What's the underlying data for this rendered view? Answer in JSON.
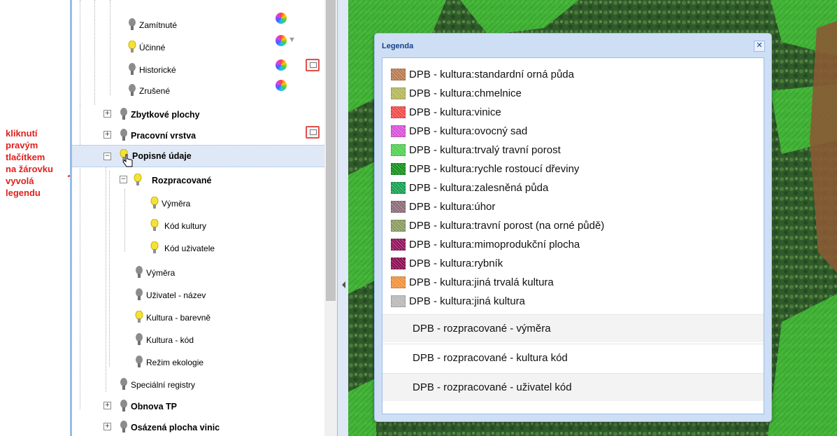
{
  "annotation": {
    "lines": [
      "kliknutí",
      "pravým",
      "tlačítkem",
      "na žárovku",
      "vyvolá",
      "legendu"
    ],
    "color": "#e0201c"
  },
  "tree": {
    "items": [
      {
        "label": "Zamítnuté",
        "bulb": "gray"
      },
      {
        "label": "Účinné",
        "bulb": "yellow"
      },
      {
        "label": "Historické",
        "bulb": "gray"
      },
      {
        "label": "Zrušené",
        "bulb": "gray"
      },
      {
        "label": "Zbytkové plochy",
        "bulb": "gray"
      },
      {
        "label": "Pracovní vrstva",
        "bulb": "gray"
      },
      {
        "label": "Popisné údaje",
        "bulb": "yellow"
      },
      {
        "label": "Rozpracované",
        "bulb": "yellow"
      },
      {
        "label": "Výměra",
        "bulb": "yellow"
      },
      {
        "label": "Kód kultury",
        "bulb": "yellow"
      },
      {
        "label": "Kód uživatele",
        "bulb": "yellow"
      },
      {
        "label": "Výměra",
        "bulb": "gray"
      },
      {
        "label": "Uživatel - název",
        "bulb": "gray"
      },
      {
        "label": "Kultura - barevně",
        "bulb": "yellow"
      },
      {
        "label": "Kultura - kód",
        "bulb": "gray"
      },
      {
        "label": "Režim ekologie",
        "bulb": "gray"
      },
      {
        "label": "Speciální registry",
        "bulb": "gray"
      },
      {
        "label": "Obnova TP",
        "bulb": "gray"
      },
      {
        "label": "Osázená plocha vinic",
        "bulb": "gray"
      }
    ],
    "expander_plus": "+",
    "expander_minus": "−"
  },
  "legend": {
    "title": "Legenda",
    "close": "✕",
    "items": [
      {
        "label": "DPB - kultura:standardní orná půda",
        "color": "#b87a4f"
      },
      {
        "label": "DPB - kultura:chmelnice",
        "color": "#b5b55a"
      },
      {
        "label": "DPB - kultura:vinice",
        "color": "#f04848"
      },
      {
        "label": "DPB - kultura:ovocný sad",
        "color": "#d850d8"
      },
      {
        "label": "DPB - kultura:trvalý travní porost",
        "color": "#50d050"
      },
      {
        "label": "DPB - kultura:rychle rostoucí dřeviny",
        "color": "#109018"
      },
      {
        "label": "DPB - kultura:zalesněná půda",
        "color": "#14a050"
      },
      {
        "label": "DPB - kultura:úhor",
        "color": "#8a6a78"
      },
      {
        "label": "DPB - kultura:travní porost (na orné půdě)",
        "color": "#8a9a60"
      },
      {
        "label": "DPB - kultura:mimoprodukční plocha",
        "color": "#90105a"
      },
      {
        "label": "DPB - kultura:rybník",
        "color": "#8a0a50"
      },
      {
        "label": "DPB - kultura:jiná trvalá kultura",
        "color": "#f0903a"
      },
      {
        "label": "DPB - kultura:jiná kultura",
        "color": "#b8b8b8"
      }
    ],
    "rows": [
      "DPB - rozpracované - výměra",
      "DPB - rozpracované - kultura kód",
      "DPB - rozpracované - uživatel kód"
    ]
  }
}
